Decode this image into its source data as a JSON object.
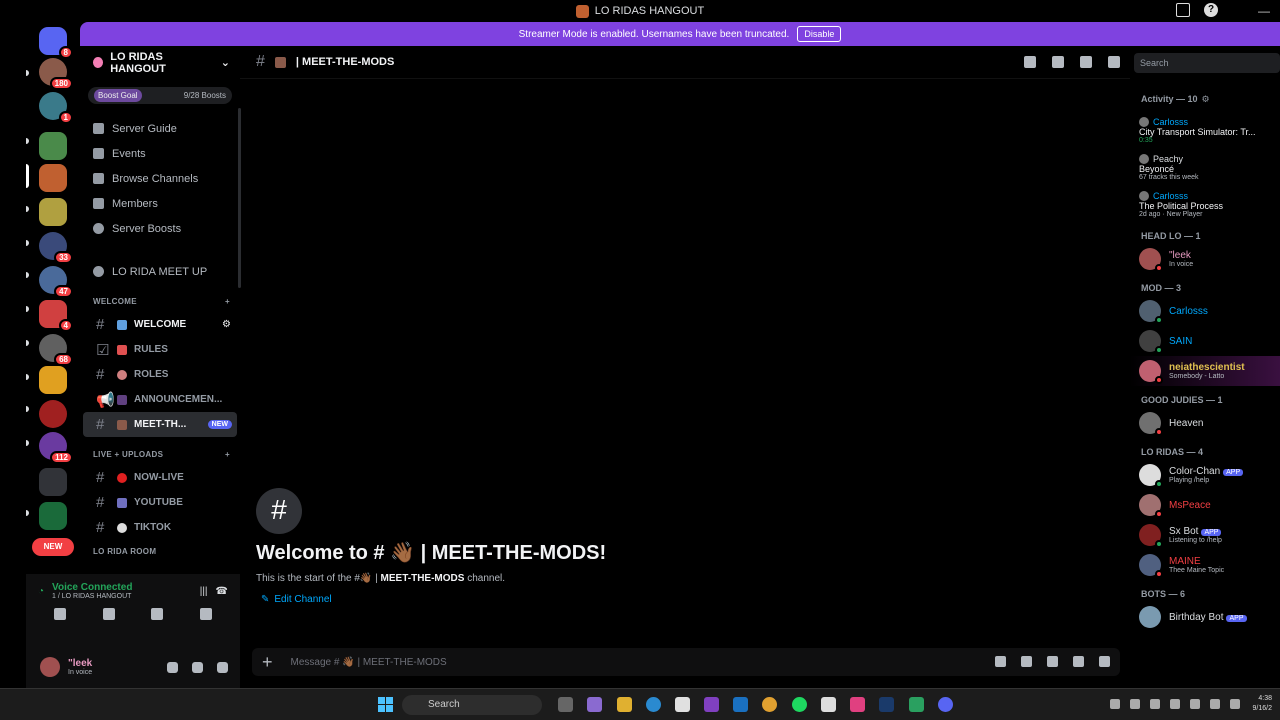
{
  "window": {
    "title": "LO RIDAS HANGOUT"
  },
  "banner": {
    "text": "Streamer Mode is enabled. Usernames have been truncated.",
    "button": "Disable"
  },
  "server": {
    "name": "LO RIDAS HANGOUT",
    "boost_goal": "Boost Goal",
    "boost_count": "9/28 Boosts"
  },
  "guild_badges": [
    "8",
    "180",
    "1",
    "",
    "",
    "",
    "33",
    "47",
    "4",
    "68",
    "",
    "",
    "112"
  ],
  "nav": [
    "Server Guide",
    "Events",
    "Browse Channels",
    "Members",
    "Server Boosts"
  ],
  "voice_channel": "LO RIDA MEET UP",
  "categories": [
    {
      "name": "WELCOME",
      "channels": [
        "WELCOME",
        "RULES",
        "ROLES",
        "ANNOUNCEMEN...",
        "MEET-TH..."
      ]
    },
    {
      "name": "LIVE + UPLOADS",
      "channels": [
        "NOW-LIVE",
        "YOUTUBE",
        "TIKTOK"
      ]
    },
    {
      "name": "LO RIDA ROOM"
    }
  ],
  "new_tag": "NEW",
  "voice": {
    "title": "Voice Connected",
    "sub": "1 / LO RIDAS HANGOUT"
  },
  "user": {
    "name": "\"leek",
    "status": "In voice"
  },
  "channel": {
    "name": "MEET-THE-MODS"
  },
  "search_placeholder": "Search",
  "welcome": {
    "title": "Welcome to # 👋🏾 | MEET-THE-MODS!",
    "sub_prefix": "This is the start of the #👋🏾 |",
    "sub_channel": "MEET-THE-MODS",
    "sub_suffix": "channel.",
    "edit": "Edit Channel"
  },
  "message_placeholder": "Message # 👋🏾 | MEET-THE-MODS",
  "members": {
    "activity_header": "Activity — 10",
    "activity": [
      {
        "user": "Carlosss",
        "title": "City Transport Simulator: Tr...",
        "sub": "0:35"
      },
      {
        "user": "Peachy",
        "title": "Beyoncé",
        "sub": "67 tracks this week"
      },
      {
        "user": "Carlosss",
        "title": "The Political Process",
        "sub": "2d ago · New Player"
      }
    ],
    "groups": [
      {
        "header": "HEAD LO — 1",
        "members": [
          {
            "name": "\"leek",
            "sub": "In voice"
          }
        ]
      },
      {
        "header": "MOD — 3",
        "members": [
          {
            "name": "Carlosss",
            "sub": ""
          },
          {
            "name": "SAIN",
            "sub": ""
          },
          {
            "name": "neiathescientist",
            "sub": "Somebody - Latto"
          }
        ]
      },
      {
        "header": "GOOD JUDIES — 1",
        "members": [
          {
            "name": "Heaven",
            "sub": ""
          }
        ]
      },
      {
        "header": "LO RIDAS — 4",
        "members": [
          {
            "name": "Color-Chan",
            "sub": "Playing /help",
            "app": "APP"
          },
          {
            "name": "MsPeace",
            "sub": ""
          },
          {
            "name": "Sx Bot",
            "sub": "Listening to /help",
            "app": "APP"
          },
          {
            "name": "MAINE",
            "sub": "Thee Maine Topic"
          }
        ]
      },
      {
        "header": "BOTS — 6",
        "members": [
          {
            "name": "Birthday Bot",
            "sub": "",
            "app": "APP"
          }
        ]
      }
    ]
  },
  "taskbar": {
    "search": "Search",
    "time": "4:38",
    "date": "9/16/2"
  },
  "colors": {
    "accent": "#7f42e0",
    "blurple": "#5865f2",
    "green": "#23a55a",
    "red": "#f23f43"
  }
}
